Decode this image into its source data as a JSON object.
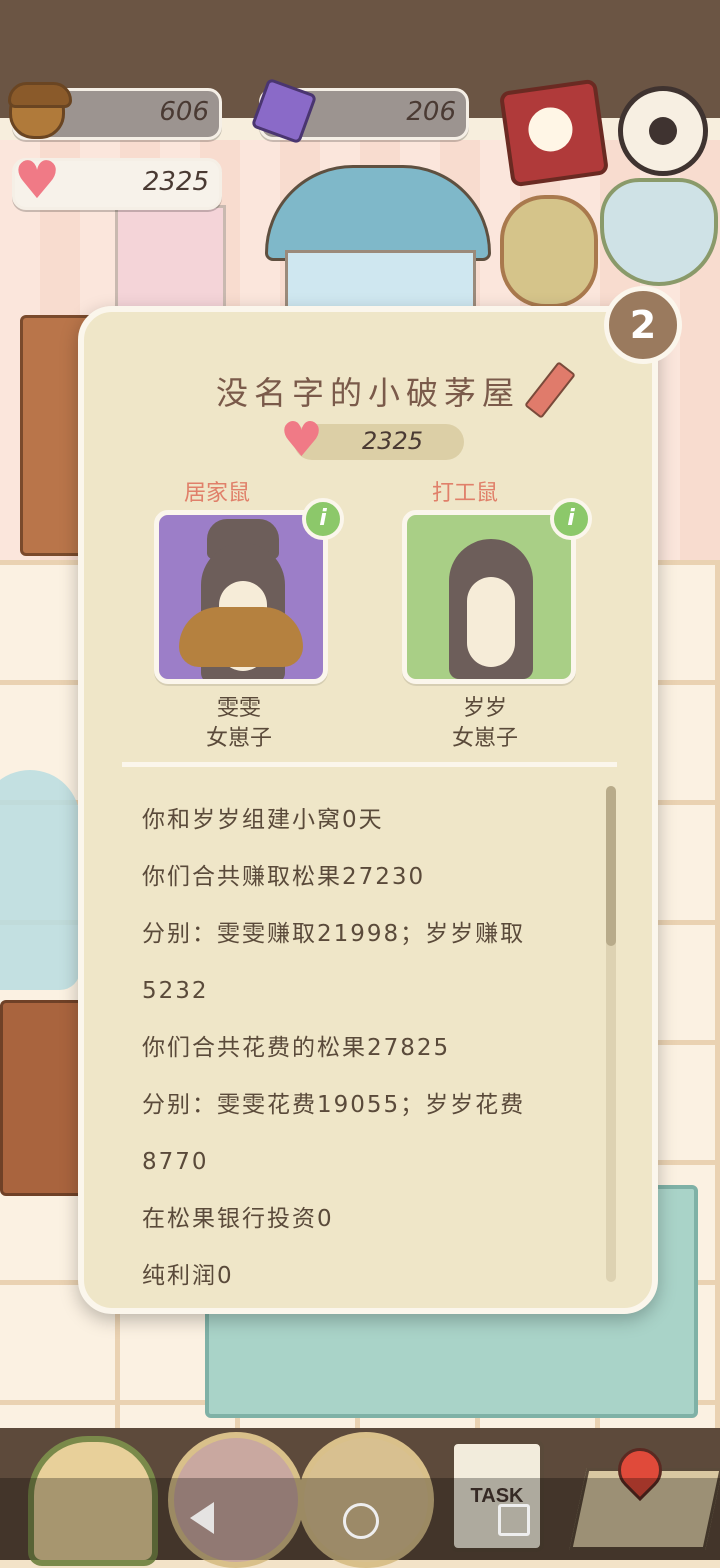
{
  "hud": {
    "acorns": "606",
    "gems": "206",
    "hearts": "2325"
  },
  "popup": {
    "title": "没名字的小破茅屋",
    "hearts": "2325",
    "residents": [
      {
        "role": "居家鼠",
        "name": "雯雯",
        "gender": "女崽子"
      },
      {
        "role": "打工鼠",
        "name": "岁岁",
        "gender": "女崽子"
      }
    ],
    "info_badge": "i",
    "back_badge": "2",
    "stats": [
      "你和岁岁组建小窝0天",
      "你们合共赚取松果27230",
      "分别：雯雯赚取21998；岁岁赚取",
      "5232",
      "你们合共花费的松果27825",
      "分别：雯雯花费19055；岁岁花费",
      "8770",
      "在松果银行投资0",
      "纯利润0"
    ]
  },
  "bottom_nav": {
    "task_label": "TASK"
  }
}
